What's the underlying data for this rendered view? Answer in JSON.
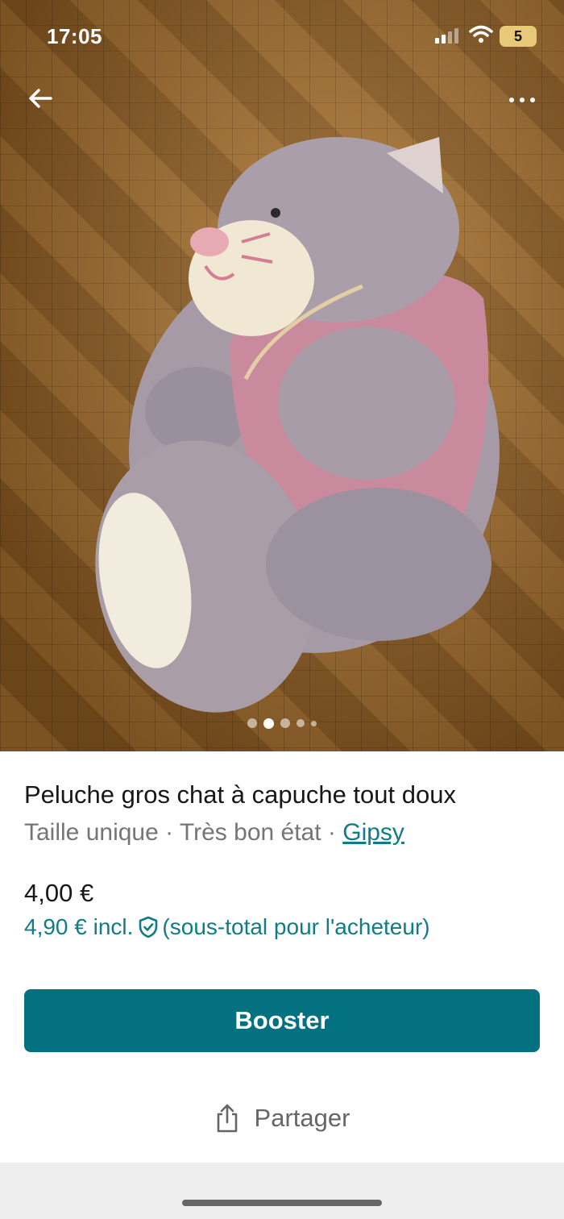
{
  "status_bar": {
    "time": "17:05",
    "battery": "5"
  },
  "photo": {
    "page_count": 5,
    "active_index": 1
  },
  "listing": {
    "title": "Peluche gros chat à capuche tout doux",
    "size": "Taille unique",
    "condition": "Très bon état",
    "separator": " · ",
    "brand": "Gipsy",
    "price": "4,00 €",
    "price_incl": "4,90 € incl.",
    "price_incl_note": "(sous-total pour l'acheteur)"
  },
  "actions": {
    "booster_label": "Booster",
    "share_label": "Partager"
  },
  "icons": {
    "back": "arrow-left-icon",
    "more": "more-horizontal-icon",
    "shield": "shield-check-icon",
    "share": "share-icon"
  },
  "colors": {
    "accent": "#037180",
    "link": "#0f7c86",
    "muted_text": "#757575"
  }
}
